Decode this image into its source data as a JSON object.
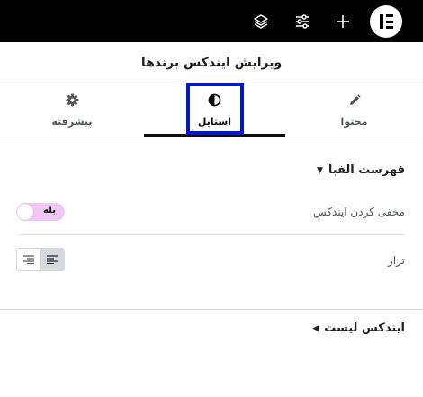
{
  "topbar": {
    "icons": [
      "layers-icon",
      "sliders-icon",
      "plus-icon",
      "elementor-logo-icon"
    ]
  },
  "panel": {
    "title": "ویرایش ایندکس برندها"
  },
  "tabs": [
    {
      "label": "محتوا",
      "icon": "pencil-icon",
      "active": false
    },
    {
      "label": "استایل",
      "icon": "contrast-icon",
      "active": true
    },
    {
      "label": "پیشرفته",
      "icon": "gear-icon",
      "active": false
    }
  ],
  "section_alphabet": {
    "title": "فهرست الفبا",
    "expanded": true,
    "hide_index": {
      "label": "مخفی کردن ایندکس",
      "toggle_text": "بله",
      "on": true
    },
    "alignment": {
      "label": "تراز",
      "selected": "left"
    }
  },
  "section_index_list": {
    "title": "ایندکس لیست",
    "expanded": false
  },
  "colors": {
    "toggle_bg": "#f2c6f2",
    "focus_outline": "#0018c9"
  }
}
